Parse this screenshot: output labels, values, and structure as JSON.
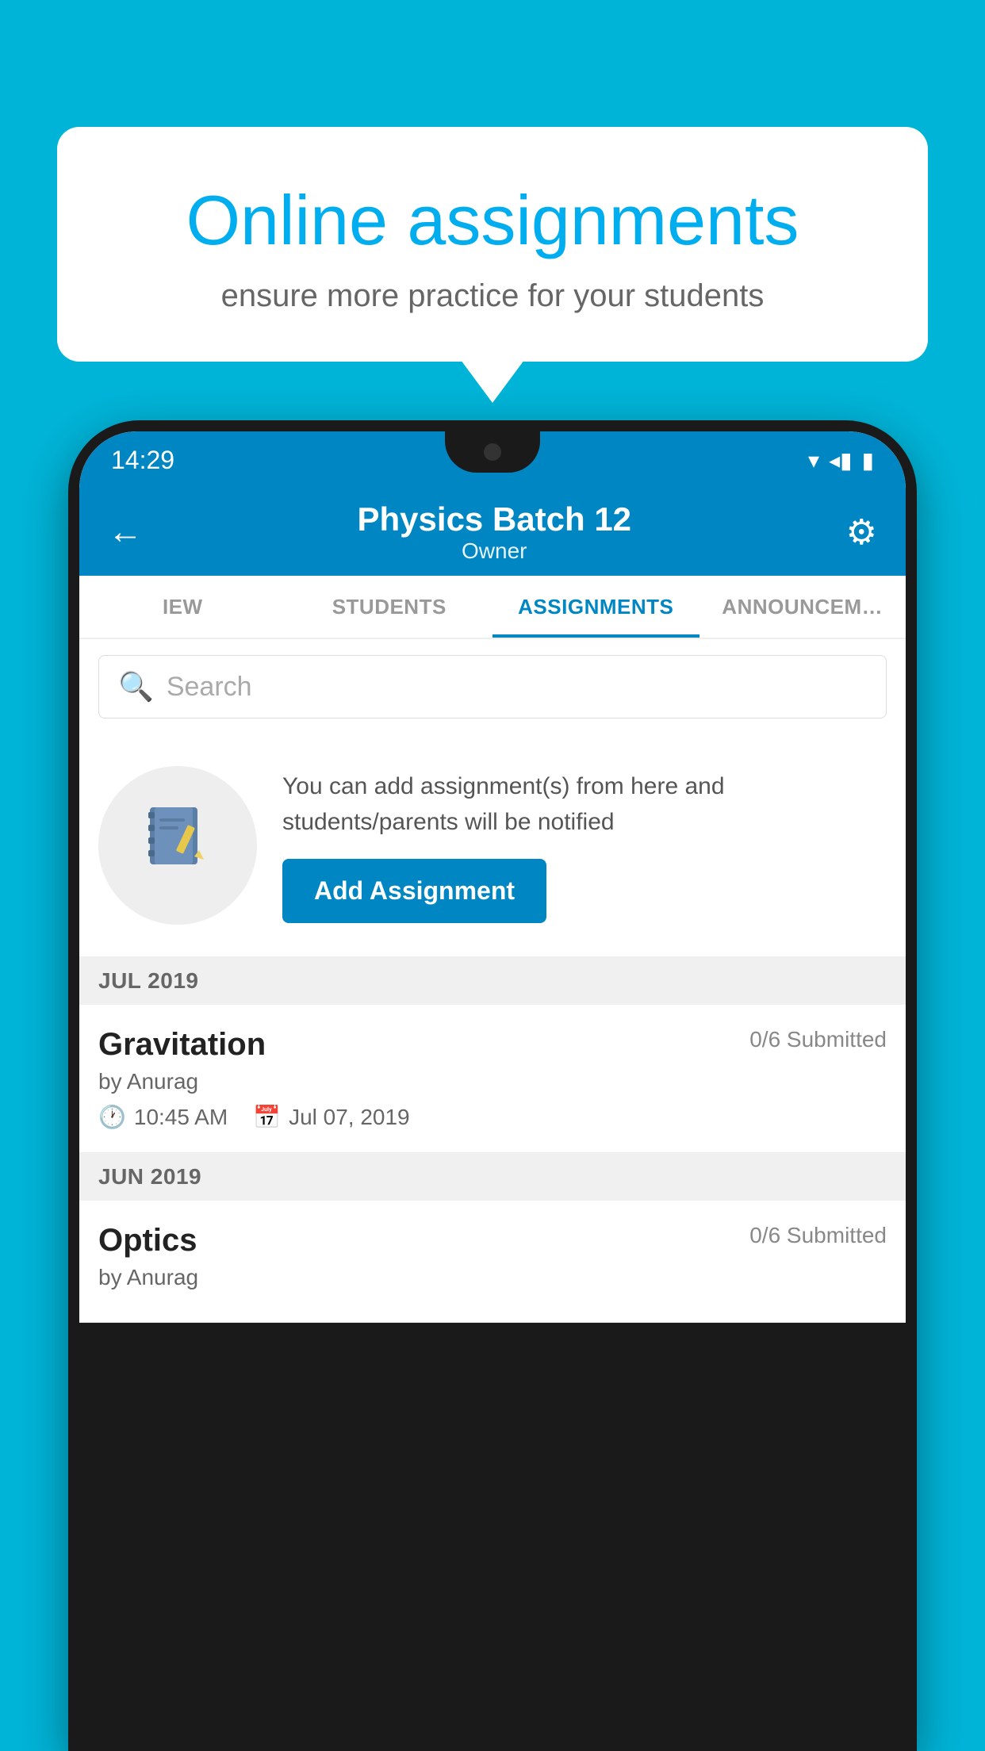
{
  "background": {
    "color": "#00B4D8"
  },
  "speech_bubble": {
    "title": "Online assignments",
    "subtitle": "ensure more practice for your students"
  },
  "status_bar": {
    "time": "14:29",
    "signal": "▾◂▮"
  },
  "app_header": {
    "title": "Physics Batch 12",
    "subtitle": "Owner",
    "back_icon": "←",
    "settings_icon": "⚙"
  },
  "tabs": [
    {
      "label": "IEW",
      "active": false
    },
    {
      "label": "STUDENTS",
      "active": false
    },
    {
      "label": "ASSIGNMENTS",
      "active": true
    },
    {
      "label": "ANNOUNCEM…",
      "active": false
    }
  ],
  "search": {
    "placeholder": "Search"
  },
  "add_assignment": {
    "icon": "📓",
    "info_text": "You can add assignment(s) from here and students/parents will be notified",
    "button_label": "Add Assignment"
  },
  "sections": [
    {
      "month": "JUL 2019",
      "assignments": [
        {
          "name": "Gravitation",
          "submitted": "0/6 Submitted",
          "by": "by Anurag",
          "time": "10:45 AM",
          "date": "Jul 07, 2019"
        }
      ]
    },
    {
      "month": "JUN 2019",
      "assignments": [
        {
          "name": "Optics",
          "submitted": "0/6 Submitted",
          "by": "by Anurag",
          "time": "",
          "date": ""
        }
      ]
    }
  ]
}
